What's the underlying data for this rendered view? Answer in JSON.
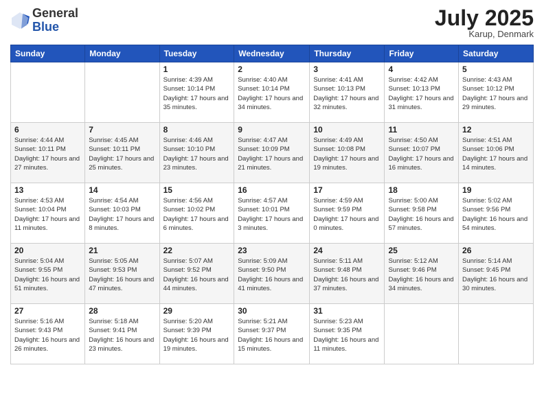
{
  "header": {
    "logo_general": "General",
    "logo_blue": "Blue",
    "month_title": "July 2025",
    "location": "Karup, Denmark"
  },
  "columns": [
    "Sunday",
    "Monday",
    "Tuesday",
    "Wednesday",
    "Thursday",
    "Friday",
    "Saturday"
  ],
  "weeks": [
    [
      {
        "day": "",
        "info": ""
      },
      {
        "day": "",
        "info": ""
      },
      {
        "day": "1",
        "info": "Sunrise: 4:39 AM\nSunset: 10:14 PM\nDaylight: 17 hours and 35 minutes."
      },
      {
        "day": "2",
        "info": "Sunrise: 4:40 AM\nSunset: 10:14 PM\nDaylight: 17 hours and 34 minutes."
      },
      {
        "day": "3",
        "info": "Sunrise: 4:41 AM\nSunset: 10:13 PM\nDaylight: 17 hours and 32 minutes."
      },
      {
        "day": "4",
        "info": "Sunrise: 4:42 AM\nSunset: 10:13 PM\nDaylight: 17 hours and 31 minutes."
      },
      {
        "day": "5",
        "info": "Sunrise: 4:43 AM\nSunset: 10:12 PM\nDaylight: 17 hours and 29 minutes."
      }
    ],
    [
      {
        "day": "6",
        "info": "Sunrise: 4:44 AM\nSunset: 10:11 PM\nDaylight: 17 hours and 27 minutes."
      },
      {
        "day": "7",
        "info": "Sunrise: 4:45 AM\nSunset: 10:11 PM\nDaylight: 17 hours and 25 minutes."
      },
      {
        "day": "8",
        "info": "Sunrise: 4:46 AM\nSunset: 10:10 PM\nDaylight: 17 hours and 23 minutes."
      },
      {
        "day": "9",
        "info": "Sunrise: 4:47 AM\nSunset: 10:09 PM\nDaylight: 17 hours and 21 minutes."
      },
      {
        "day": "10",
        "info": "Sunrise: 4:49 AM\nSunset: 10:08 PM\nDaylight: 17 hours and 19 minutes."
      },
      {
        "day": "11",
        "info": "Sunrise: 4:50 AM\nSunset: 10:07 PM\nDaylight: 17 hours and 16 minutes."
      },
      {
        "day": "12",
        "info": "Sunrise: 4:51 AM\nSunset: 10:06 PM\nDaylight: 17 hours and 14 minutes."
      }
    ],
    [
      {
        "day": "13",
        "info": "Sunrise: 4:53 AM\nSunset: 10:04 PM\nDaylight: 17 hours and 11 minutes."
      },
      {
        "day": "14",
        "info": "Sunrise: 4:54 AM\nSunset: 10:03 PM\nDaylight: 17 hours and 8 minutes."
      },
      {
        "day": "15",
        "info": "Sunrise: 4:56 AM\nSunset: 10:02 PM\nDaylight: 17 hours and 6 minutes."
      },
      {
        "day": "16",
        "info": "Sunrise: 4:57 AM\nSunset: 10:01 PM\nDaylight: 17 hours and 3 minutes."
      },
      {
        "day": "17",
        "info": "Sunrise: 4:59 AM\nSunset: 9:59 PM\nDaylight: 17 hours and 0 minutes."
      },
      {
        "day": "18",
        "info": "Sunrise: 5:00 AM\nSunset: 9:58 PM\nDaylight: 16 hours and 57 minutes."
      },
      {
        "day": "19",
        "info": "Sunrise: 5:02 AM\nSunset: 9:56 PM\nDaylight: 16 hours and 54 minutes."
      }
    ],
    [
      {
        "day": "20",
        "info": "Sunrise: 5:04 AM\nSunset: 9:55 PM\nDaylight: 16 hours and 51 minutes."
      },
      {
        "day": "21",
        "info": "Sunrise: 5:05 AM\nSunset: 9:53 PM\nDaylight: 16 hours and 47 minutes."
      },
      {
        "day": "22",
        "info": "Sunrise: 5:07 AM\nSunset: 9:52 PM\nDaylight: 16 hours and 44 minutes."
      },
      {
        "day": "23",
        "info": "Sunrise: 5:09 AM\nSunset: 9:50 PM\nDaylight: 16 hours and 41 minutes."
      },
      {
        "day": "24",
        "info": "Sunrise: 5:11 AM\nSunset: 9:48 PM\nDaylight: 16 hours and 37 minutes."
      },
      {
        "day": "25",
        "info": "Sunrise: 5:12 AM\nSunset: 9:46 PM\nDaylight: 16 hours and 34 minutes."
      },
      {
        "day": "26",
        "info": "Sunrise: 5:14 AM\nSunset: 9:45 PM\nDaylight: 16 hours and 30 minutes."
      }
    ],
    [
      {
        "day": "27",
        "info": "Sunrise: 5:16 AM\nSunset: 9:43 PM\nDaylight: 16 hours and 26 minutes."
      },
      {
        "day": "28",
        "info": "Sunrise: 5:18 AM\nSunset: 9:41 PM\nDaylight: 16 hours and 23 minutes."
      },
      {
        "day": "29",
        "info": "Sunrise: 5:20 AM\nSunset: 9:39 PM\nDaylight: 16 hours and 19 minutes."
      },
      {
        "day": "30",
        "info": "Sunrise: 5:21 AM\nSunset: 9:37 PM\nDaylight: 16 hours and 15 minutes."
      },
      {
        "day": "31",
        "info": "Sunrise: 5:23 AM\nSunset: 9:35 PM\nDaylight: 16 hours and 11 minutes."
      },
      {
        "day": "",
        "info": ""
      },
      {
        "day": "",
        "info": ""
      }
    ]
  ]
}
